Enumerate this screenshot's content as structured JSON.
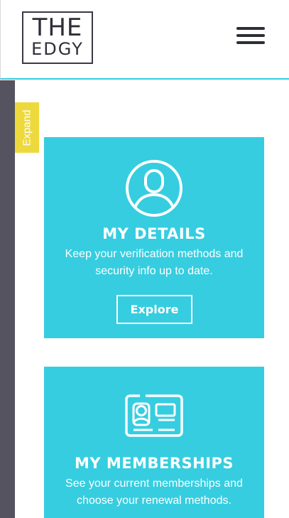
{
  "brand": {
    "line1": "THE",
    "line2": "EDGY"
  },
  "header": {
    "menu_icon": "hamburger-menu-icon"
  },
  "sidebar": {
    "expand_label": "Expand"
  },
  "colors": {
    "accent": "#36cde0",
    "rail": "#54535f",
    "expand_tab": "#eed93c",
    "text_dark": "#2e2e38"
  },
  "cards": [
    {
      "icon": "user-circle-icon",
      "title": "MY DETAILS",
      "description": "Keep your verification methods and security info up to date.",
      "button_label": "Explore"
    },
    {
      "icon": "id-card-icon",
      "title": "MY MEMBERSHIPS",
      "description": "See your current memberships and choose your renewal methods."
    }
  ]
}
